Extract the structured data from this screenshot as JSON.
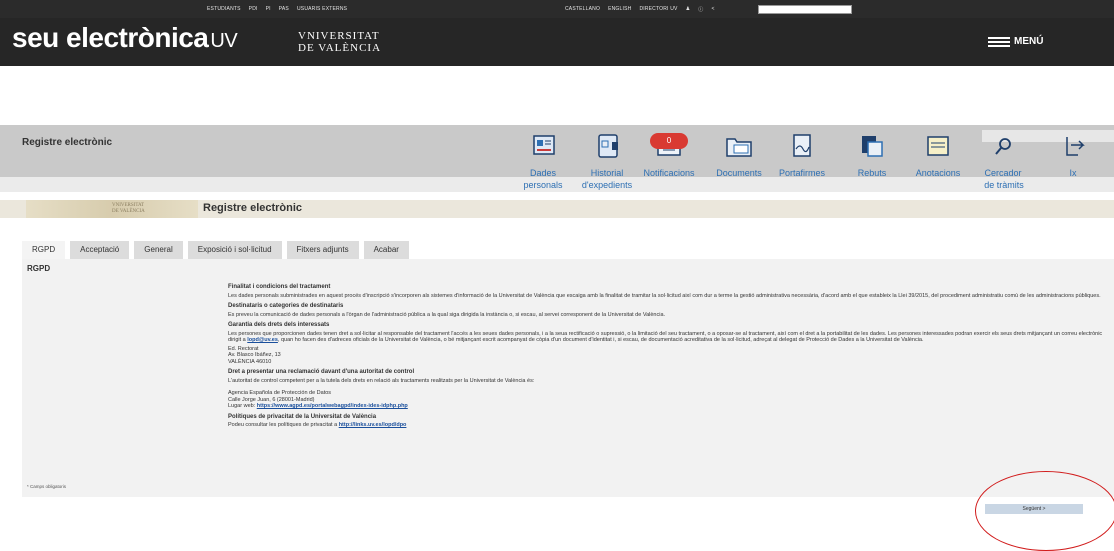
{
  "topbar": {
    "links": [
      "ESTUDIANTS",
      "PDI",
      "PI",
      "PAS",
      "USUARIS EXTERNS"
    ],
    "right_links": [
      "CASTELLANO",
      "ENGLISH",
      "DIRECTORI UV"
    ]
  },
  "header": {
    "logo": "seu electrònica",
    "logo_suffix": "UV",
    "university_line1": "VNIVERSITAT",
    "university_line2": "DE VALÈNCIA",
    "menu_label": "MENÚ"
  },
  "registre": {
    "title": "Registre electrònic",
    "nav": [
      {
        "label1": "Dades",
        "label2": "personals",
        "icon": "id-card-icon"
      },
      {
        "label1": "Historial",
        "label2": "d'expedients",
        "icon": "folder-history-icon"
      },
      {
        "label1": "Notificacions",
        "label2": "",
        "icon": "notification-icon"
      },
      {
        "label1": "Documents",
        "label2": "",
        "icon": "documents-icon"
      },
      {
        "label1": "Portafirmes",
        "label2": "",
        "icon": "signature-icon"
      },
      {
        "label1": "Rebuts",
        "label2": "",
        "icon": "receipts-icon"
      },
      {
        "label1": "Anotacions",
        "label2": "",
        "icon": "notes-icon"
      },
      {
        "label1": "Cercador",
        "label2": "de tràmits",
        "icon": "search-icon"
      },
      {
        "label1": "Ix",
        "label2": "",
        "icon": "exit-icon"
      }
    ],
    "notification_count": "0"
  },
  "brand": {
    "shield_line1": "VNIVERSITAT",
    "shield_line2": "DE VALÈNCIA",
    "page_title": "Registre electrònic"
  },
  "tabs": [
    "RGPD",
    "Acceptació",
    "General",
    "Exposició i sol·licitud",
    "Fitxers adjunts",
    "Acabar"
  ],
  "panel": {
    "title": "RGPD",
    "sections": [
      {
        "heading": "Finalitat i condicions del tractament",
        "text": "Les dades personals subministrades en aquest procés d'inscripció s'incorporen als sistemes d'informació de la Universitat de València que escaiga amb la finalitat de tramitar la sol·licitud així com dur a terme la gestió administrativa necessària, d'acord amb el que estableix la Llei 39/2015, del procediment administratiu comú de les administracions públiques."
      },
      {
        "heading": "Destinataris o categories de destinataris",
        "text": "Es preveu la comunicació de dades personals a l'òrgan de l'administració pública a la qual siga dirigida la instància o, si escau, al servei corresponent de la Universitat de València."
      },
      {
        "heading": "Garantia dels drets dels interessats",
        "text": "Les persones que proporcionen dades tenen dret a sol·licitar al responsable del tractament l'accés a les seues dades personals, i a la seua rectificació o supressió, o la limitació del seu tractament, o a oposar-se al tractament, així com el dret a la portabilitat de les dades. Les persones interessades podran exercir els seus drets mitjançant un correu electrònic dirigit a",
        "link": "lopd@uv.es",
        "text_after": ", quan ho facen des d'adreces oficials de la Universitat de València, o bé mitjançant escrit acompanyat de còpia d'un document d'identitat i, si escau, de documentació acreditativa de la sol·licitud, adreçat al delegat de Protecció de Dades a la Universitat de València.",
        "address": [
          "Ed. Rectorat",
          "Av. Blasco Ibáñez, 13",
          "VALÈNCIA 46010"
        ]
      },
      {
        "heading": "Dret a presentar una reclamació davant d'una autoritat de control",
        "text": "L'autoritat de control competent per a la tutela dels drets en relació als tractaments realitzats per la Universitat de València és:",
        "address": [
          "Agencia Española de Protección de Datos",
          "Calle Jorge Juan, 6 (28001-Madrid)"
        ],
        "web_label": "Lugar web:",
        "web_link": "https://www.agpd.es/portalwebagpd/index-ides-idphp.php"
      },
      {
        "heading": "Polítiques de privacitat de la Universitat de València",
        "text": "Podeu consultar les polítiques de privacitat a",
        "link": "http://links.uv.es/lopd/dpo"
      }
    ],
    "required_note": "* Camps obligatoris",
    "next_button": "Següent >"
  }
}
